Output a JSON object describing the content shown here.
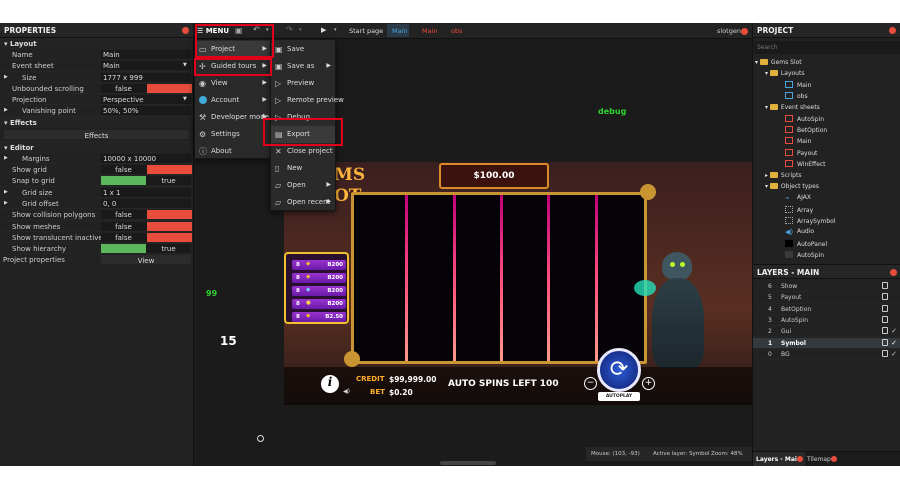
{
  "properties": {
    "title": "PROPERTIES",
    "sections": {
      "layout": "Layout",
      "effects": "Effects",
      "editor": "Editor"
    },
    "layout_rows": [
      {
        "label": "Name",
        "value": "Main"
      },
      {
        "label": "Event sheet",
        "value": "Main"
      },
      {
        "label": "Size",
        "value": "1777 x 999"
      },
      {
        "label": "Unbounded scrolling",
        "value": "false"
      },
      {
        "label": "Projection",
        "value": "Perspective"
      },
      {
        "label": "Vanishing point",
        "value": "50%, 50%"
      }
    ],
    "effects_button": "Effects",
    "editor_rows": [
      {
        "label": "Margins",
        "value": "10000 x 10000"
      },
      {
        "label": "Show grid",
        "value": "false"
      },
      {
        "label": "Snap to grid",
        "value": "true"
      },
      {
        "label": "Grid size",
        "value": "1 x 1"
      },
      {
        "label": "Grid offset",
        "value": "0, 0"
      },
      {
        "label": "Show collision polygons",
        "value": "false"
      },
      {
        "label": "Show meshes",
        "value": "false"
      },
      {
        "label": "Show translucent inactive layers",
        "value": "false"
      },
      {
        "label": "Show hierarchy",
        "value": "true"
      }
    ],
    "project_properties": {
      "label": "Project properties",
      "button": "View"
    }
  },
  "toolbar": {
    "menu_label": "MENU",
    "tabs": [
      "Start page",
      "Main",
      "Main",
      "obs"
    ],
    "user": "slotgen"
  },
  "main_menu": {
    "items": [
      "Project",
      "Guided tours",
      "View",
      "Account",
      "Developer mode",
      "Settings",
      "About"
    ]
  },
  "project_menu": {
    "items": [
      "Save",
      "Save as",
      "Preview",
      "Remote preview",
      "Debug",
      "Export",
      "Close project",
      "New",
      "Open",
      "Open recent"
    ]
  },
  "canvas": {
    "debug_text": "debug",
    "number_99": "99",
    "number_15": "15",
    "game": {
      "win_box": "$100.00",
      "logo_fragment_1": "MS",
      "logo_fragment_2": "OT",
      "paytable": [
        {
          "count": "8",
          "amount": "B200"
        },
        {
          "count": "8",
          "amount": "B200"
        },
        {
          "count": "8",
          "amount": "B200"
        },
        {
          "count": "8",
          "amount": "B200"
        },
        {
          "count": "8",
          "amount": "B2.50"
        }
      ],
      "credit_label": "CREDIT",
      "credit_value": "$99,999.00",
      "bet_label": "BET",
      "bet_value": "$0.20",
      "auto_spins": "AUTO SPINS LEFT 100",
      "autoplay": "AUTOPLAY",
      "info": "i"
    }
  },
  "status": {
    "mouse": "Mouse: (103, -93)",
    "active_layer": "Active layer: Symbol",
    "zoom": "Zoom: 48%"
  },
  "project": {
    "title": "PROJECT",
    "search_placeholder": "Search",
    "root": "Gems Slot",
    "folders": {
      "layouts": "Layouts",
      "event_sheets": "Event sheets",
      "scripts": "Scripts",
      "object_types": "Object types"
    },
    "layouts": [
      "Main",
      "obs"
    ],
    "event_sheets": [
      "AutoSpin",
      "BetOption",
      "Main",
      "Payout",
      "WinEffect"
    ],
    "object_types": [
      "AJAX",
      "Array",
      "ArraySymbol",
      "Audio",
      "AutoPanel",
      "AutoSpin"
    ]
  },
  "layers": {
    "title": "LAYERS - MAIN",
    "rows": [
      {
        "n": "6",
        "name": "Show"
      },
      {
        "n": "5",
        "name": "Payout"
      },
      {
        "n": "4",
        "name": "BetOption"
      },
      {
        "n": "3",
        "name": "AutoSpin"
      },
      {
        "n": "2",
        "name": "Gui"
      },
      {
        "n": "1",
        "name": "Symbol"
      },
      {
        "n": "0",
        "name": "BG"
      }
    ],
    "bottom_tabs": [
      "Layers - Main",
      "Tilemap"
    ]
  },
  "colors": {
    "accent_red": "#e74c3c",
    "toggle_green": "#5cb85c",
    "highlight": "#e0001a",
    "tab_blue": "#4aa3df"
  }
}
